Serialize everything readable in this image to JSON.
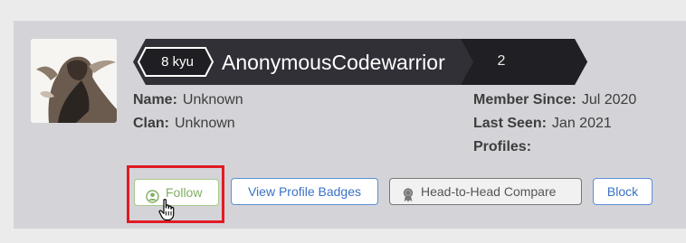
{
  "profile": {
    "rank": "8 kyu",
    "username": "AnonymousCodewarrior",
    "honor": "2",
    "name_label": "Name:",
    "name_value": "Unknown",
    "clan_label": "Clan:",
    "clan_value": "Unknown",
    "member_since_label": "Member Since:",
    "member_since_value": "Jul 2020",
    "last_seen_label": "Last Seen:",
    "last_seen_value": "Jan 2021",
    "profiles_label": "Profiles:"
  },
  "actions": {
    "follow": "Follow",
    "view_badges": "View Profile Badges",
    "compare": "Head-to-Head Compare",
    "block": "Block"
  },
  "icons": {
    "follow": "user-circle-icon",
    "compare": "medal-icon",
    "cursor": "hand-pointer-icon"
  },
  "colors": {
    "follow": "#7fae63",
    "link_button": "#3a72c4",
    "highlight": "#e01b24",
    "rank_bar": "#303036"
  }
}
